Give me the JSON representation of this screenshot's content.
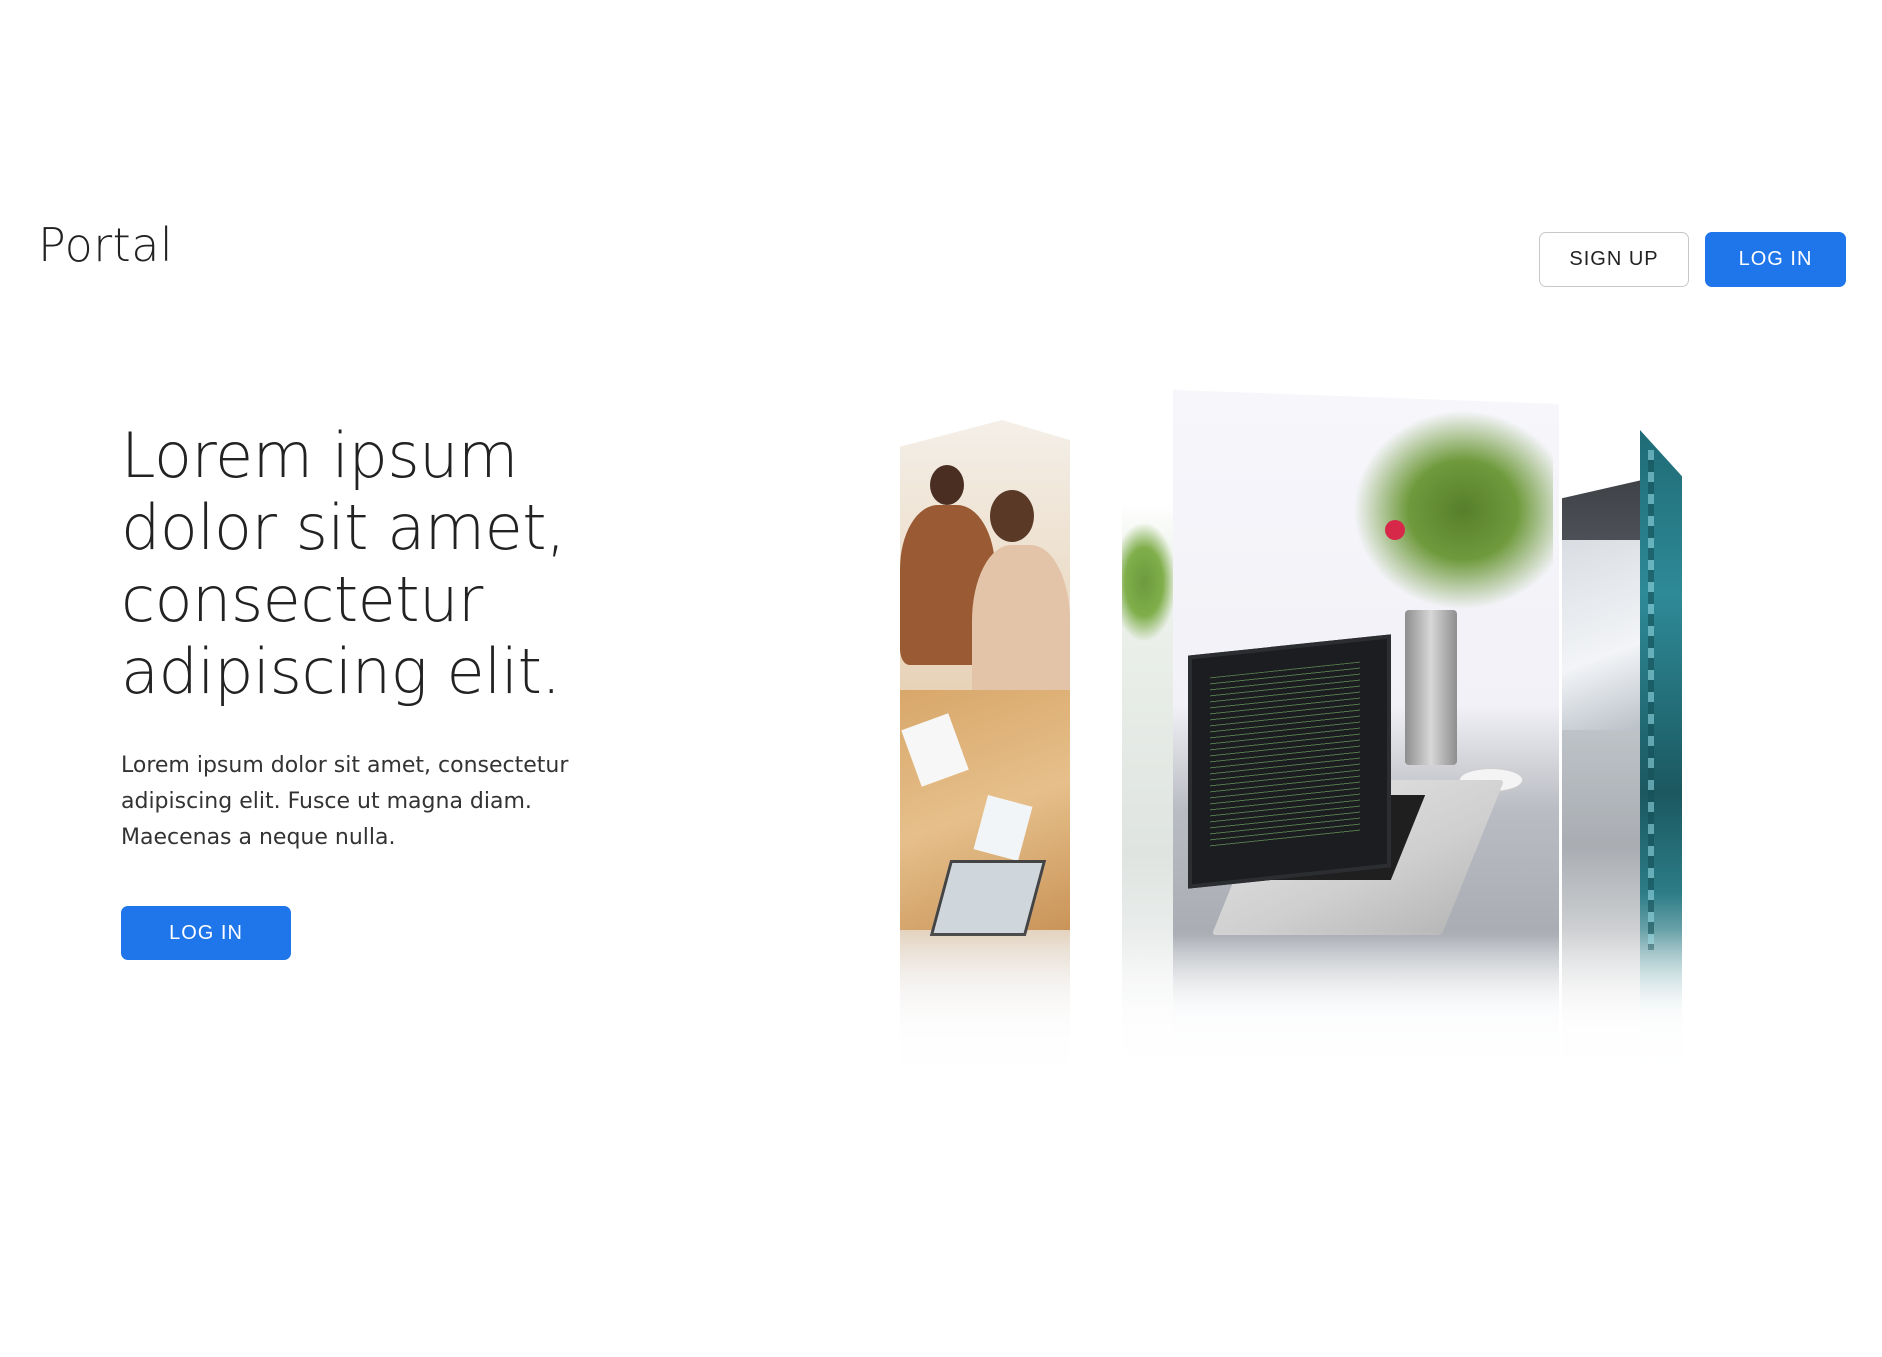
{
  "header": {
    "brand": "Portal",
    "signup_label": "SIGN UP",
    "login_label": "LOG IN"
  },
  "hero": {
    "title": "Lorem ipsum dolor sit amet, consectetur adipiscing elit.",
    "body": "Lorem ipsum dolor sit amet, consectetur adipiscing elit. Fusce ut magna diam. Maecenas a neque nulla.",
    "login_label": "LOG IN"
  },
  "carousel": {
    "panels": [
      "meeting-photo",
      "plant-photo",
      "laptop-desk-photo",
      "laptop-photo",
      "teal-photo"
    ]
  },
  "colors": {
    "primary": "#1f75ea",
    "text": "#222222",
    "outline_border": "#c8c8c8",
    "background": "#ffffff"
  }
}
